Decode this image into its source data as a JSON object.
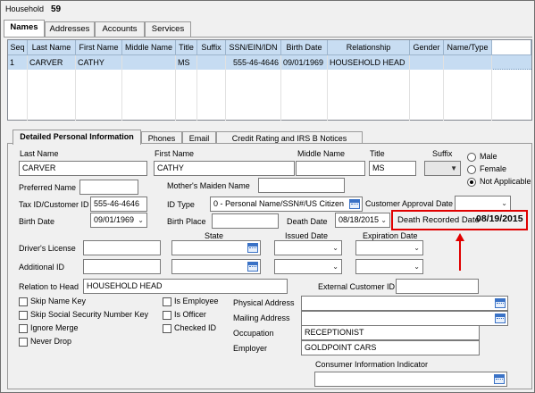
{
  "household": {
    "label": "Household",
    "number": "59"
  },
  "tabs": [
    "Names",
    "Addresses",
    "Accounts",
    "Services"
  ],
  "grid": {
    "headers": [
      "Seq",
      "Last Name",
      "First Name",
      "Middle Name",
      "Title",
      "Suffix",
      "SSN/EIN/IDN",
      "Birth Date",
      "Relationship",
      "Gender",
      "Name/Type"
    ],
    "rows": [
      [
        "1",
        "CARVER",
        "CATHY",
        "",
        "MS",
        "",
        "555-46-4646",
        "09/01/1969",
        "HOUSEHOLD HEAD",
        "",
        ""
      ]
    ]
  },
  "subtabs": [
    "Detailed Personal Information",
    "Phones",
    "Email",
    "Credit Rating and IRS B Notices"
  ],
  "form": {
    "last_name_label": "Last Name",
    "last_name": "CARVER",
    "first_name_label": "First Name",
    "first_name": "CATHY",
    "middle_name_label": "Middle Name",
    "middle_name": "",
    "title_label": "Title",
    "title": "MS",
    "suffix_label": "Suffix",
    "suffix": "",
    "gender_options": [
      "Male",
      "Female",
      "Not Applicable"
    ],
    "gender_selected": "Not Applicable",
    "preferred_name_label": "Preferred Name",
    "preferred_name": "",
    "mothers_maiden_label": "Mother's Maiden Name",
    "mothers_maiden": "",
    "tax_id_label": "Tax ID/Customer ID",
    "tax_id": "555-46-4646",
    "id_type_label": "ID Type",
    "id_type": "0 - Personal Name/SSN#/US Citizen",
    "customer_approval_label": "Customer Approval Date",
    "customer_approval": "",
    "birth_date_label": "Birth Date",
    "birth_date": "09/01/1969",
    "birth_place_label": "Birth Place",
    "birth_place": "",
    "death_date_label": "Death Date",
    "death_date": "08/18/2015",
    "death_recorded_label": "Death Recorded Date",
    "death_recorded": "08/19/2015",
    "state_label": "State",
    "issued_date_label": "Issued Date",
    "expiration_date_label": "Expiration Date",
    "drivers_license_label": "Driver's License",
    "drivers_license": "",
    "additional_id_label": "Additional ID",
    "additional_id": "",
    "relation_label": "Relation to Head",
    "relation": "HOUSEHOLD HEAD",
    "external_id_label": "External Customer ID",
    "external_id": "",
    "checkboxes_left": [
      "Skip Name Key",
      "Skip Social Security Number Key",
      "Ignore Merge",
      "Never Drop"
    ],
    "checkboxes_mid": [
      "Is Employee",
      "Is Officer",
      "Checked ID"
    ],
    "physical_address_label": "Physical Address",
    "physical_address": "",
    "mailing_address_label": "Mailing Address",
    "mailing_address": "",
    "occupation_label": "Occupation",
    "occupation": "RECEPTIONIST",
    "employer_label": "Employer",
    "employer": "GOLDPOINT CARS",
    "consumer_info_label": "Consumer Information Indicator",
    "consumer_info": ""
  },
  "colors": {
    "highlight": "#e00000",
    "grid_header": "#c8ddf2",
    "grid_selected_row": "#c6dcf2"
  }
}
